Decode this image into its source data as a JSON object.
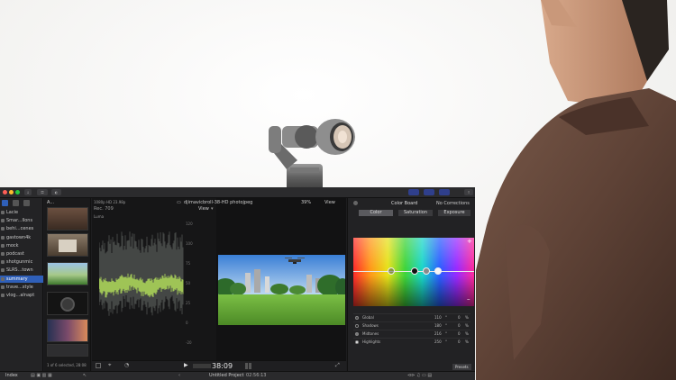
{
  "app": {
    "sidebar": {
      "items": [
        {
          "label": "Lacie"
        },
        {
          "label": "Smar...llons"
        },
        {
          "label": "behi...cenes"
        },
        {
          "label": "gastown4k"
        },
        {
          "label": "mock"
        },
        {
          "label": "podcast"
        },
        {
          "label": "shotgunmic"
        },
        {
          "label": "SLRS...town"
        },
        {
          "label": "summary"
        },
        {
          "label": "trave...style"
        },
        {
          "label": "vlog...alnapt"
        }
      ],
      "selected_index": 8
    },
    "browser": {
      "header_label": "A...",
      "status": "1 of 6 selected, 28:08"
    },
    "scopes": {
      "format": "1080p HD 23.98p",
      "standard": "Rec. 709",
      "channel": "Luma",
      "view_label": "View",
      "ticks": [
        "120",
        "100",
        "75",
        "50",
        "25",
        "0",
        "-20"
      ]
    },
    "viewer": {
      "clip_name": "djimavicbroll-38-HD photojpeg",
      "zoom": "39%",
      "view_label": "View"
    },
    "transport": {
      "timecode": "38:09"
    },
    "inspector": {
      "title": "Color Board",
      "corrections_label": "No Corrections",
      "tabs": [
        {
          "label": "Color"
        },
        {
          "label": "Saturation"
        },
        {
          "label": "Exposure"
        }
      ],
      "selected_tab": 0,
      "pucks": [
        {
          "label": "Global",
          "angle": "110",
          "percent": "0"
        },
        {
          "label": "Shadows",
          "angle": "180",
          "percent": "0"
        },
        {
          "label": "Midtones",
          "angle": "216",
          "percent": "0"
        },
        {
          "label": "Highlights",
          "angle": "250",
          "percent": "0"
        }
      ],
      "degree_unit": "°",
      "percent_unit": "%",
      "plus_label": "+",
      "minus_label": "–",
      "presets_label": "Presets"
    },
    "timeline": {
      "index_label": "Index",
      "project_name": "Untitled Project",
      "duration": "02:56:13"
    }
  },
  "colors": {
    "accent": "#2f5fb8",
    "panel": "#1d1d1f",
    "waveform": "#b7e35a"
  }
}
